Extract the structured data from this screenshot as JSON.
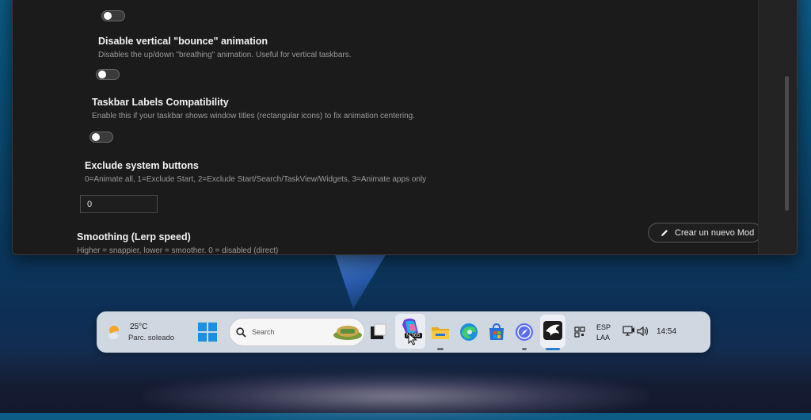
{
  "settings": {
    "bounce": {
      "title": "Disable vertical \"bounce\" animation",
      "desc": "Disables the up/down \"breathing\" animation. Useful for vertical taskbars."
    },
    "labels": {
      "title": "Taskbar Labels Compatibility",
      "desc": "Enable this if your taskbar shows window titles (rectangular icons) to fix animation centering."
    },
    "exclude": {
      "title": "Exclude system buttons",
      "desc": "0=Animate all, 1=Exclude Start, 2=Exclude Start/Search/TaskView/Widgets, 3=Animate apps only",
      "value": "0"
    },
    "smoothing": {
      "title": "Smoothing (Lerp speed)",
      "desc": "Higher = snappier, lower = smoother. 0 = disabled (direct)"
    }
  },
  "new_mod_button": {
    "label": "Crear un nuevo Mod"
  },
  "taskbar": {
    "weather": {
      "temp": "25°C",
      "condition": "Parc. soleado"
    },
    "search": {
      "label": "Search"
    },
    "copilot_badge": "M365",
    "tray": {
      "lang1": "ESP",
      "lang2": "LAA",
      "time": "14:54"
    }
  },
  "colors": {
    "window_bg": "#1b1b1b",
    "taskbar_bg": "#dee4ec",
    "accent": "#2b7cd3"
  }
}
